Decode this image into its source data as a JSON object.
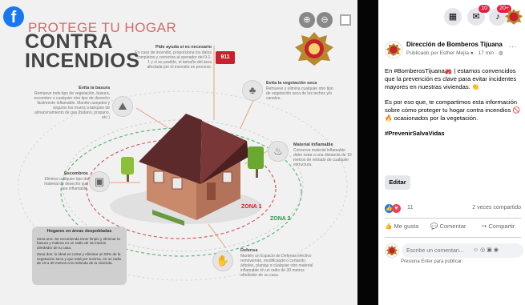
{
  "infographic": {
    "title_line1": "PROTEGE TU HOGAR",
    "title_line2": "CONTRA",
    "title_line3": "INCENDIOS",
    "panels": {
      "help": {
        "heading": "Pide ayuda si es necesario",
        "body": "En caso de incendio, proporciona los datos completos y correctos al operador del 9-1-1 y si es posible, el tamaño del área afectada por el incendio en proceso."
      },
      "trash": {
        "heading": "Evita la basura",
        "body": "Remueve todo tipo de vegetación, basura, escombro o cualquier otro tipo de desecho fácilmente inflamable. Mantén aseados y seguros los muros o tanques de almacenamiento de gas (butano, propano, etc.)"
      },
      "dry_veg": {
        "heading": "Evita la vegetación seca",
        "body": "Remueve y elimina cualquier otro tipo de vegetación seca de los techos y/o canales."
      },
      "debris": {
        "heading": "Escombros",
        "body": "Elimina cualquier tipo de material de desecho que sea inflamable."
      },
      "flammable": {
        "heading": "Material Inflamable",
        "body": "Conserve material inflamable debe estar a una distancia de 10 metros de retirado de cualquier estructura."
      },
      "defense": {
        "heading": "Defensa",
        "body": "Mantén un Espacio de Defensa efectivo removiendo, modificando o cortando árboles, plantas o cualquier otro material inflamable en un radio de 30 metros alrededor de su casa."
      },
      "hint_box": {
        "heading": "Hogares en áreas despobladas",
        "body1": "Zona uno: Se recomienda tener limpio y eliminar la basura y maleza en un radio de 15 metros alrededor de tu casa.",
        "body2": "Zona dos: lo ideal es cortar y eliminar un 50% de la vegetación seca y que está por encima, en un radio de 15 a 30 metros a la redonda de tu vivienda."
      }
    },
    "zone1": "ZONA 1",
    "zone2": "ZONA 2",
    "phone_digits": "911"
  },
  "topbar": {
    "messenger_count": "10",
    "notifications_count": "20+"
  },
  "post": {
    "page_name": "Dirección de Bomberos Tijuana",
    "meta": "Publicado por Esther Mejía ● · 17 min · ◍",
    "para1": "En #BomberosTijuana🚒 | estamos convencidos que la prevención es clave para evitar incidentes mayores en nuestras viviendas. 👏",
    "para2": "Es por eso que, te compartimos esta información sobre cómo proteger tu hogar contra incendios 🚫🔥 ocasionados por la vegetación.",
    "para3": "#PrevenirSalvaVidas",
    "edit_label": "Editar",
    "reaction_count": "11",
    "shares": "2 veces compartido",
    "like_label": "Me gusta",
    "comment_label": "Comentar",
    "share_label": "Compartir",
    "comment_placeholder": "Escribe un comentari...",
    "enter_hint": "Presiona Enter para publicar."
  },
  "colors": {
    "facebook_blue": "#1877f2",
    "zone1_red": "#c8202c",
    "zone2_green": "#1fa04a",
    "notif_red": "#e41e3f"
  }
}
